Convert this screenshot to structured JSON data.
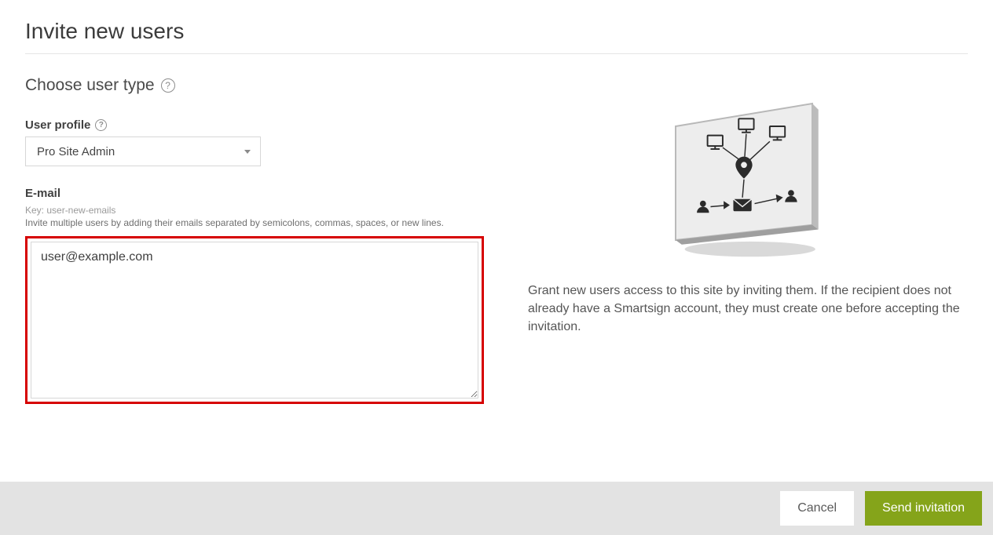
{
  "title": "Invite new users",
  "subheading": "Choose user type",
  "userProfile": {
    "label": "User profile",
    "value": "Pro Site Admin"
  },
  "email": {
    "label": "E-mail",
    "key": "Key: user-new-emails",
    "hint": "Invite multiple users by adding their emails separated by semicolons, commas, spaces, or new lines.",
    "value": "user@example.com"
  },
  "description": "Grant new users access to this site by inviting them. If the recipient does not already have a Smartsign account, they must create one before accepting the invitation.",
  "footer": {
    "cancel": "Cancel",
    "send": "Send invitation"
  },
  "helpGlyph": "?"
}
